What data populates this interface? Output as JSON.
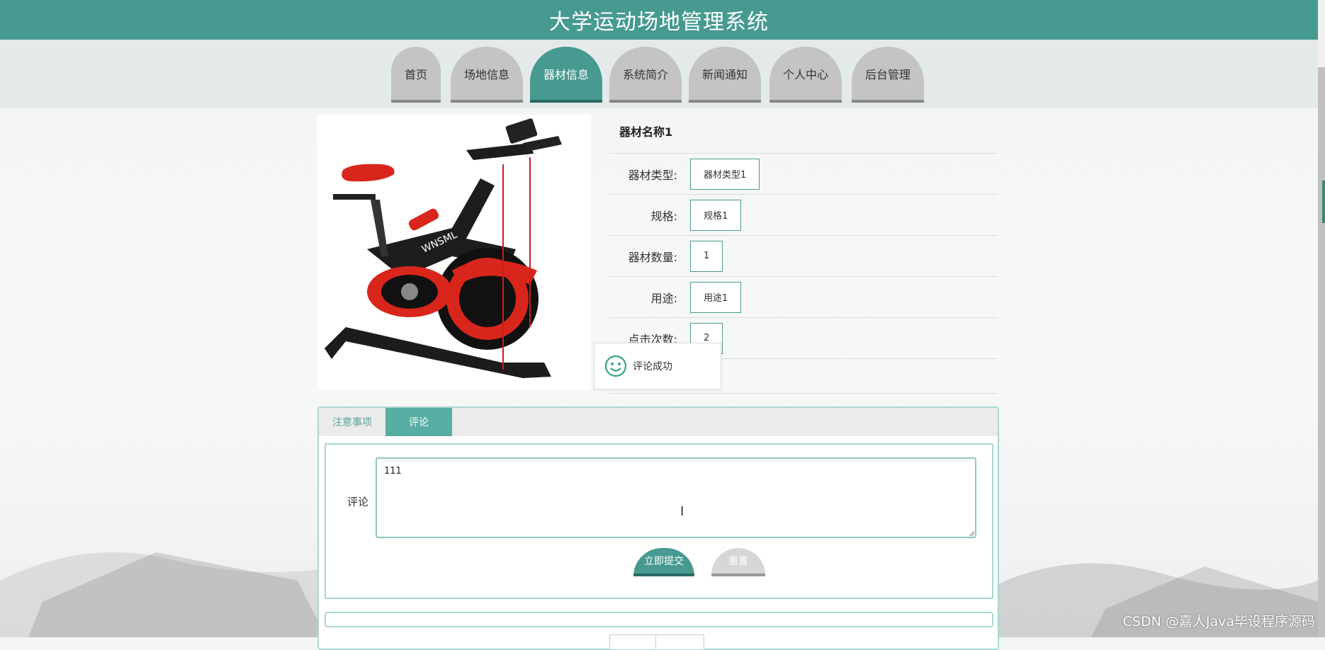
{
  "header": {
    "title": "大学运动场地管理系统"
  },
  "nav": {
    "items": [
      {
        "label": "首页"
      },
      {
        "label": "场地信息"
      },
      {
        "label": "器材信息"
      },
      {
        "label": "系统简介"
      },
      {
        "label": "新闻通知"
      },
      {
        "label": "个人中心"
      },
      {
        "label": "后台管理"
      }
    ],
    "active": "器材信息"
  },
  "equipment": {
    "name": "器材名称1",
    "fields": [
      {
        "label": "器材类型:",
        "value": "器材类型1"
      },
      {
        "label": "规格:",
        "value": "规格1"
      },
      {
        "label": "器材数量:",
        "value": "1"
      },
      {
        "label": "用途:",
        "value": "用途1"
      },
      {
        "label": "点击次数:",
        "value": "2"
      }
    ],
    "image_icon": "exercise-bike-photo"
  },
  "toast": {
    "message": "评论成功",
    "icon": "smile-icon"
  },
  "tabs": {
    "items": [
      {
        "label": "注意事项"
      },
      {
        "label": "评论"
      }
    ],
    "active": "评论"
  },
  "comment_form": {
    "label": "评论",
    "value": "111",
    "submit_label": "立即提交",
    "reset_label": "重置"
  },
  "watermark": "CSDN @嘉人Java毕设程序源码",
  "colors": {
    "primary": "#469a90",
    "nav_inactive": "#c4c4c4",
    "border_teal": "#a8d8d2"
  }
}
